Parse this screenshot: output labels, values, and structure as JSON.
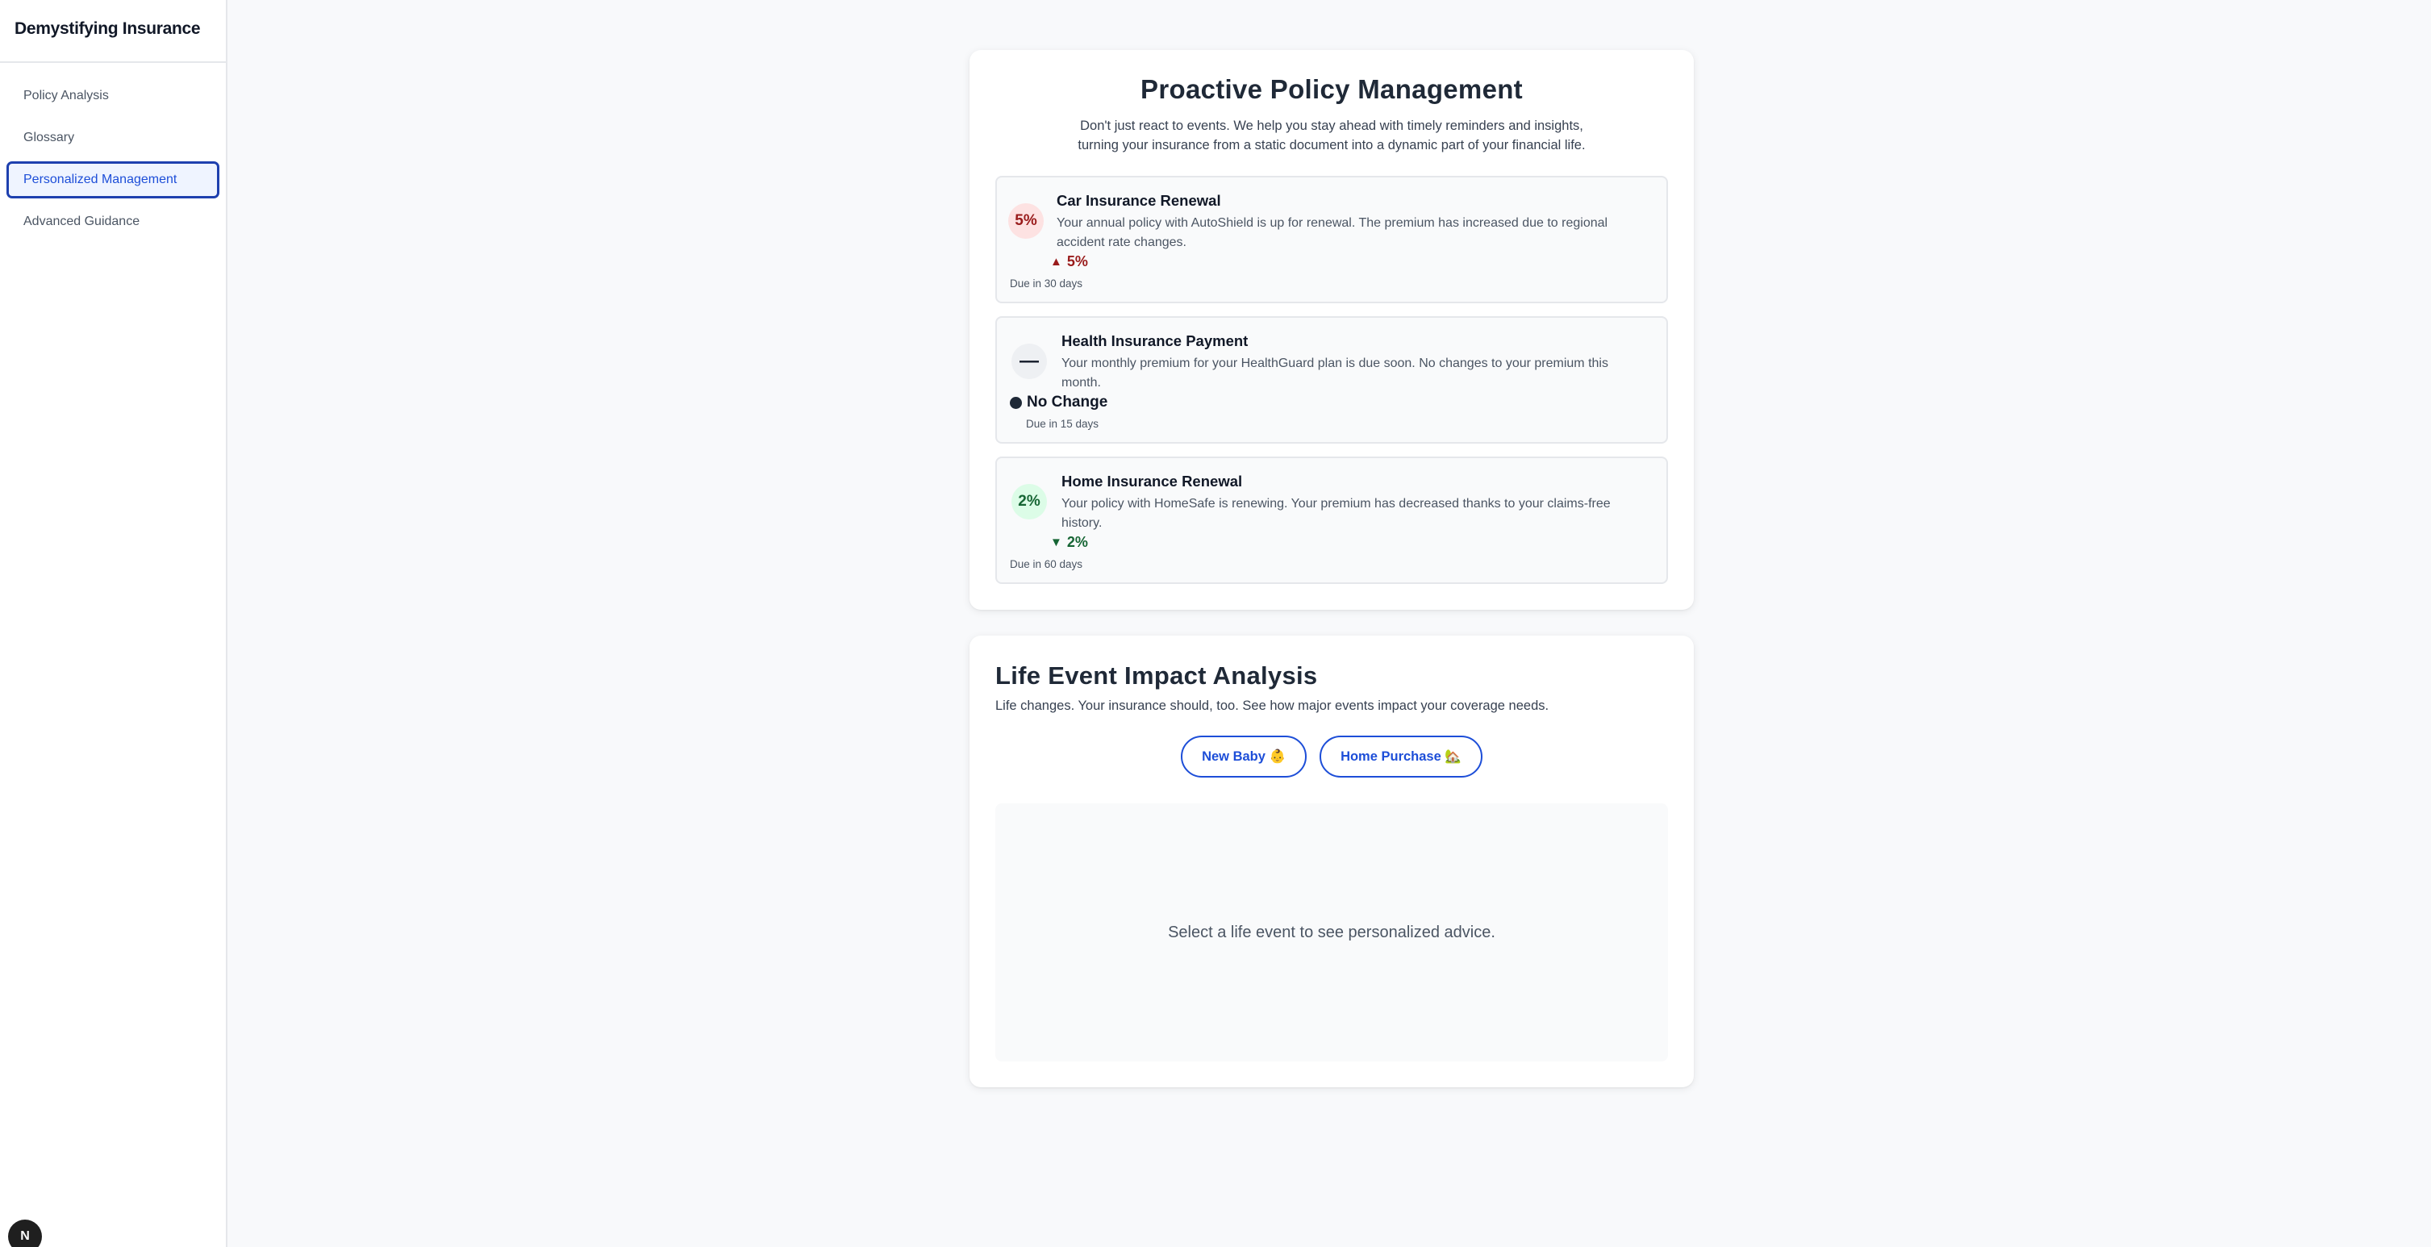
{
  "brand": "Demystifying Insurance",
  "nav": [
    {
      "label": "Policy Analysis",
      "active": false
    },
    {
      "label": "Glossary",
      "active": false
    },
    {
      "label": "Personalized Management",
      "active": true
    },
    {
      "label": "Advanced Guidance",
      "active": false
    }
  ],
  "corner_badge": "N",
  "policy": {
    "title": "Proactive Policy Management",
    "subtitle": "Don't just react to events. We help you stay ahead with timely reminders and insights, turning your insurance from a static document into a dynamic part of your financial life.",
    "items": [
      {
        "badge": "5%",
        "title": "Car Insurance Renewal",
        "description": "Your annual policy with AutoShield is up for renewal. The premium has increased due to regional accident rate changes.",
        "change_icon": "▲",
        "change": "5%",
        "due": "Due in 30 days",
        "trend": "up",
        "color": "#991b1b"
      },
      {
        "badge": "—",
        "title": "Health Insurance Payment",
        "description": "Your monthly premium for your HealthGuard plan is due soon. No changes to your premium this month.",
        "change_icon": "●",
        "change": "No Change",
        "due": "Due in 15 days",
        "trend": "neutral",
        "color": "#111827"
      },
      {
        "badge": "2%",
        "title": "Home Insurance Renewal",
        "description": "Your policy with HomeSafe is renewing. Your premium has decreased thanks to your claims-free history.",
        "change_icon": "▼",
        "change": "2%",
        "due": "Due in 60 days",
        "trend": "down",
        "color": "#166534"
      }
    ]
  },
  "life": {
    "title": "Life Event Impact Analysis",
    "subtitle": "Life changes. Your insurance should, too. See how major events impact your coverage needs.",
    "buttons": [
      {
        "label": "New Baby 👶"
      },
      {
        "label": "Home Purchase 🏡"
      }
    ],
    "placeholder": "Select a life event to see personalized advice."
  },
  "colors": {
    "accent": "#1d4ed8",
    "up": "#991b1b",
    "down": "#166534"
  }
}
